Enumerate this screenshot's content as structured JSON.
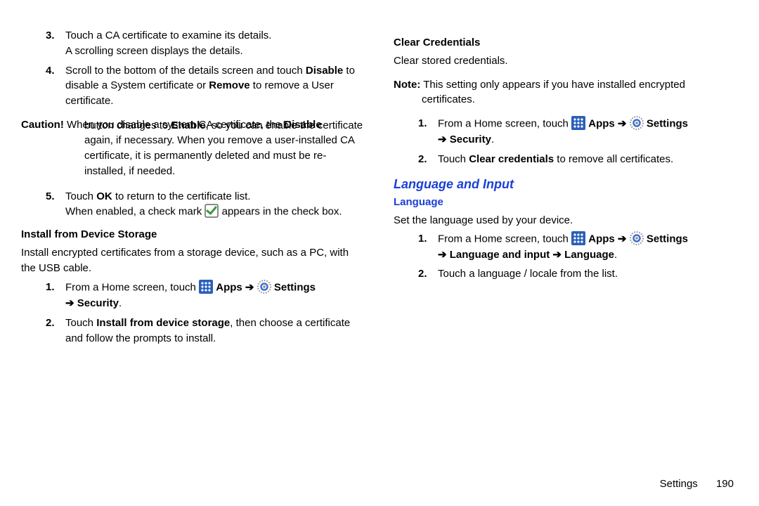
{
  "left": {
    "step3": {
      "num": "3.",
      "l1": "Touch a CA certificate to examine its details.",
      "l2": "A scrolling screen displays the details."
    },
    "step4": {
      "num": "4.",
      "pre": "Scroll to the bottom of the details screen and touch ",
      "disable": "Disable",
      "mid": " to disable a System certificate or ",
      "remove": "Remove",
      "post": " to remove a User certificate."
    },
    "caution": {
      "label": "Caution!",
      "l1": " When you disable a system CA certificate, the ",
      "disable": "Disable",
      "body": "button changes to Enable, so you can enable the certificate again, if necessary. When you remove a user-installed CA certificate, it is permanently deleted and must be re-installed, if needed."
    },
    "step5": {
      "num": "5.",
      "pre": "Touch ",
      "ok": "OK",
      "post": " to return to the certificate list.",
      "l2a": "When enabled, a check mark ",
      "l2b": " appears in the check box."
    },
    "install": {
      "title": "Install from Device Storage",
      "desc": "Install encrypted certificates from a storage device, such as a PC, with the USB cable.",
      "s1": {
        "num": "1.",
        "pre": "From a Home screen, touch ",
        "apps": " Apps ",
        "arrow1": "➔",
        "settings": " Settings ",
        "arrow2": "➔",
        "security": " Security",
        "dot": "."
      },
      "s2": {
        "num": "2.",
        "pre": "Touch ",
        "bold": "Install from device storage",
        "post": ", then choose a certificate and follow the prompts to install."
      }
    }
  },
  "right": {
    "clear": {
      "title": "Clear Credentials",
      "desc": "Clear stored credentials.",
      "note_label": "Note:",
      "note_body": " This setting only appears if you have installed encrypted certificates.",
      "s1": {
        "num": "1.",
        "pre": "From a Home screen, touch ",
        "apps": " Apps ",
        "arrow1": "➔",
        "settings": " Settings ",
        "arrow2": "➔",
        "security": " Security",
        "dot": "."
      },
      "s2": {
        "num": "2.",
        "pre": "Touch ",
        "bold": "Clear credentials",
        "post": " to remove all certificates."
      }
    },
    "lang": {
      "title": "Language and Input",
      "sub": "Language",
      "desc": "Set the language used by your device.",
      "s1": {
        "num": "1.",
        "pre": "From a Home screen, touch ",
        "apps": " Apps ",
        "arrow1": "➔",
        "settings": " Settings ",
        "arrow2": "➔",
        "li": " Language and input ",
        "arrow3": "➔",
        "lang": " Language",
        "dot": "."
      },
      "s2": {
        "num": "2.",
        "text": "Touch a language / locale from the list."
      }
    }
  },
  "footer": {
    "section": "Settings",
    "page": "190"
  }
}
